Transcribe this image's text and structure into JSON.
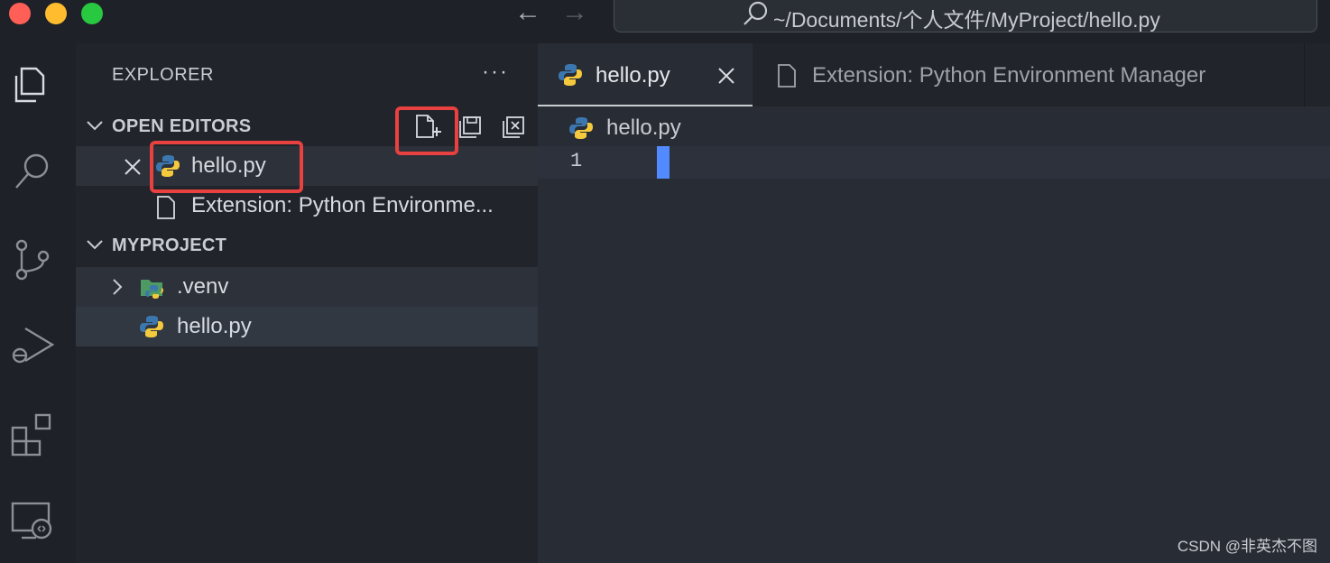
{
  "titlebar": {
    "path": "~/Documents/个人文件/MyProject/hello.py"
  },
  "activity_bar": {
    "items": [
      "explorer-icon",
      "search-icon",
      "source-control-icon",
      "run-debug-icon",
      "extensions-icon",
      "remote-explorer-icon"
    ]
  },
  "sidebar": {
    "title": "EXPLORER",
    "more": "···",
    "open_editors": {
      "label": "OPEN EDITORS",
      "items": [
        {
          "name": "hello.py",
          "icon": "python-icon"
        },
        {
          "name": "Extension: Python Environme...",
          "icon": "file-icon"
        }
      ]
    },
    "project": {
      "label": "MYPROJECT",
      "items": [
        {
          "name": ".venv",
          "icon": "venv-folder-icon"
        },
        {
          "name": "hello.py",
          "icon": "python-icon"
        }
      ]
    }
  },
  "editor": {
    "tabs": [
      {
        "label": "hello.py",
        "active": true
      },
      {
        "label": "Extension: Python Environment Manager",
        "active": false
      }
    ],
    "breadcrumb": "hello.py",
    "line_number": "1"
  },
  "watermark": "CSDN @非英杰不图",
  "colors": {
    "highlight_box": "#e8413f",
    "cursor": "#528bff"
  }
}
